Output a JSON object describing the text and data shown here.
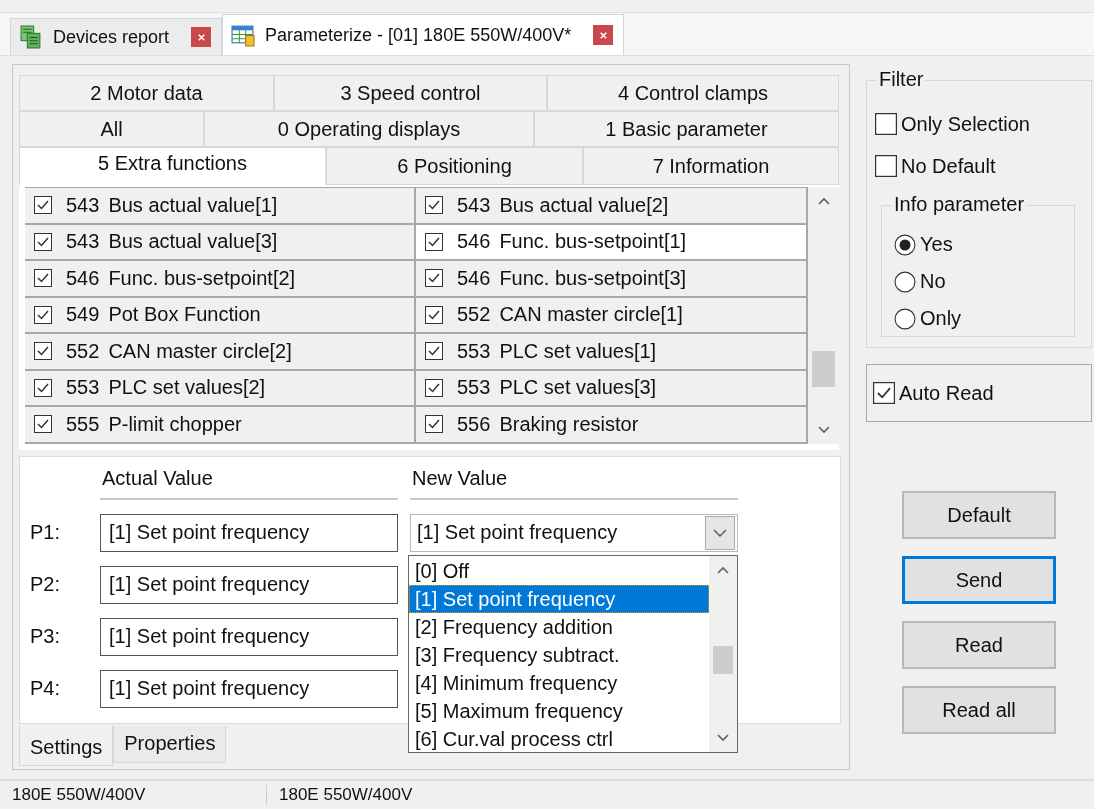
{
  "document_tabs": [
    {
      "label": "Devices report",
      "kind": "devices",
      "selected": false
    },
    {
      "label": "Parameterize - [01] 180E 550W/400V*",
      "kind": "table",
      "selected": true
    }
  ],
  "parameter_tabs": [
    [
      {
        "label": "2 Motor data",
        "selected": false
      },
      {
        "label": "3 Speed control",
        "selected": false
      },
      {
        "label": "4 Control clamps",
        "selected": false
      }
    ],
    [
      {
        "label": "All",
        "selected": false
      },
      {
        "label": "0 Operating displays",
        "selected": false
      },
      {
        "label": "1 Basic parameter",
        "selected": false
      }
    ],
    [
      {
        "label": "5 Extra functions",
        "selected": true
      },
      {
        "label": "6 Positioning",
        "selected": false
      },
      {
        "label": "7 Information",
        "selected": false
      }
    ]
  ],
  "parameters": [
    {
      "code": "543",
      "name": "Bus actual value[1]",
      "checked": true,
      "selected": false
    },
    {
      "code": "543",
      "name": "Bus actual value[2]",
      "checked": true,
      "selected": false
    },
    {
      "code": "543",
      "name": "Bus actual value[3]",
      "checked": true,
      "selected": false
    },
    {
      "code": "546",
      "name": "Func. bus-setpoint[1]",
      "checked": true,
      "selected": true
    },
    {
      "code": "546",
      "name": "Func. bus-setpoint[2]",
      "checked": true,
      "selected": false
    },
    {
      "code": "546",
      "name": "Func. bus-setpoint[3]",
      "checked": true,
      "selected": false
    },
    {
      "code": "549",
      "name": "Pot Box Function",
      "checked": true,
      "selected": false
    },
    {
      "code": "552",
      "name": "CAN master circle[1]",
      "checked": true,
      "selected": false
    },
    {
      "code": "552",
      "name": "CAN master circle[2]",
      "checked": true,
      "selected": false
    },
    {
      "code": "553",
      "name": "PLC set values[1]",
      "checked": true,
      "selected": false
    },
    {
      "code": "553",
      "name": "PLC set values[2]",
      "checked": true,
      "selected": false
    },
    {
      "code": "553",
      "name": "PLC set values[3]",
      "checked": true,
      "selected": false
    },
    {
      "code": "555",
      "name": "P-limit chopper",
      "checked": true,
      "selected": false
    },
    {
      "code": "556",
      "name": "Braking resistor",
      "checked": true,
      "selected": false
    }
  ],
  "value_editor": {
    "actual_header": "Actual Value",
    "new_header": "New Value",
    "rows": [
      {
        "label": "P1:",
        "actual": "[1] Set point frequency"
      },
      {
        "label": "P2:",
        "actual": "[1] Set point frequency"
      },
      {
        "label": "P3:",
        "actual": "[1] Set point frequency"
      },
      {
        "label": "P4:",
        "actual": "[1] Set point frequency"
      }
    ],
    "new_value": "[1] Set point frequency",
    "dropdown": {
      "expanded": true,
      "options": [
        {
          "label": "[0] Off",
          "selected": false
        },
        {
          "label": "[1] Set point frequency",
          "selected": true
        },
        {
          "label": "[2] Frequency addition",
          "selected": false
        },
        {
          "label": "[3] Frequency subtract.",
          "selected": false
        },
        {
          "label": "[4] Minimum frequency",
          "selected": false
        },
        {
          "label": "[5] Maximum frequency",
          "selected": false
        },
        {
          "label": "[6] Cur.val process ctrl",
          "selected": false
        }
      ]
    }
  },
  "bottom_tabs": [
    {
      "label": "Settings",
      "selected": true
    },
    {
      "label": "Properties",
      "selected": false
    }
  ],
  "filter": {
    "title": "Filter",
    "options": [
      {
        "label": "Only Selection",
        "checked": false
      },
      {
        "label": "No Default",
        "checked": false
      }
    ],
    "info_parameter": {
      "title": "Info parameter",
      "options": [
        {
          "label": "Yes",
          "selected": true
        },
        {
          "label": "No",
          "selected": false
        },
        {
          "label": "Only",
          "selected": false
        }
      ]
    }
  },
  "auto_read": {
    "label": "Auto Read",
    "checked": true
  },
  "buttons": [
    {
      "label": "Default",
      "focused": false
    },
    {
      "label": "Send",
      "focused": true
    },
    {
      "label": "Read",
      "focused": false
    },
    {
      "label": "Read all",
      "focused": false
    }
  ],
  "status_bar": [
    "180E 550W/400V",
    "180E 550W/400V"
  ]
}
